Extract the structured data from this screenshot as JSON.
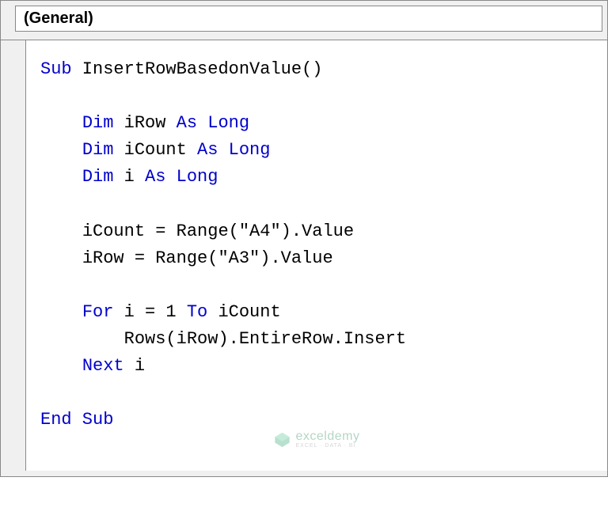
{
  "dropdown": {
    "selected": "(General)"
  },
  "code": {
    "line1": {
      "kw1": "Sub",
      "name": " InsertRowBasedonValue()"
    },
    "line2": "",
    "line3": {
      "indent": "    ",
      "kw1": "Dim",
      "mid": " iRow ",
      "kw2": "As Long"
    },
    "line4": {
      "indent": "    ",
      "kw1": "Dim",
      "mid": " iCount ",
      "kw2": "As Long"
    },
    "line5": {
      "indent": "    ",
      "kw1": "Dim",
      "mid": " i ",
      "kw2": "As Long"
    },
    "line6": "",
    "line7": {
      "indent": "    ",
      "text": "iCount = Range(\"A4\").Value"
    },
    "line8": {
      "indent": "    ",
      "text": "iRow = Range(\"A3\").Value"
    },
    "line9": "",
    "line10": {
      "indent": "    ",
      "kw1": "For",
      "mid": " i = 1 ",
      "kw2": "To",
      "end": " iCount"
    },
    "line11": {
      "indent": "        ",
      "text": "Rows(iRow).EntireRow.Insert"
    },
    "line12": {
      "indent": "    ",
      "kw1": "Next",
      "end": " i"
    },
    "line13": "",
    "line14": {
      "kw1": "End Sub"
    }
  },
  "watermark": {
    "title": "exceldemy",
    "sub": "EXCEL · DATA · BI"
  }
}
